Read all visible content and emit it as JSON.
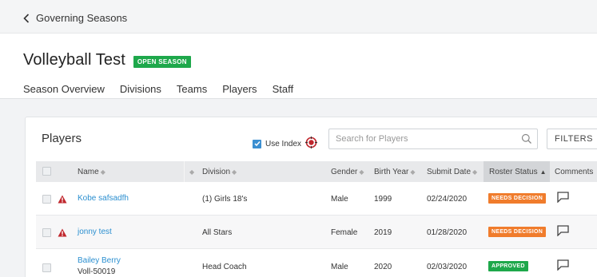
{
  "nav": {
    "back_label": "Governing Seasons"
  },
  "season": {
    "title": "Volleyball Test",
    "badge": "OPEN SEASON"
  },
  "tabs": [
    {
      "label": "Season Overview",
      "active": false
    },
    {
      "label": "Divisions",
      "active": false
    },
    {
      "label": "Teams",
      "active": false
    },
    {
      "label": "Players",
      "active": true
    },
    {
      "label": "Staff",
      "active": false
    }
  ],
  "players_panel": {
    "title": "Players",
    "use_index_label": "Use Index",
    "use_index_checked": true,
    "search_placeholder": "Search for Players",
    "filters_label": "FILTERS"
  },
  "table": {
    "columns": {
      "name": "Name",
      "division": "Division",
      "gender": "Gender",
      "birth_year": "Birth Year",
      "submit_date": "Submit Date",
      "roster_status": "Roster Status",
      "comments": "Comments"
    },
    "rows": [
      {
        "name": "Kobe safsadfh",
        "sub": "",
        "warning": true,
        "division": "(1) Girls 18's",
        "gender": "Male",
        "birth_year": "1999",
        "submit_date": "02/24/2020",
        "status": "NEEDS DECISION"
      },
      {
        "name": "jonny test",
        "sub": "",
        "warning": true,
        "division": "All Stars",
        "gender": "Female",
        "birth_year": "2019",
        "submit_date": "01/28/2020",
        "status": "NEEDS DECISION"
      },
      {
        "name": "Bailey Berry",
        "sub": "Voll-50019",
        "warning": false,
        "division": "Head Coach",
        "gender": "Male",
        "birth_year": "2020",
        "submit_date": "02/03/2020",
        "status": "APPROVED"
      }
    ]
  },
  "colors": {
    "accent": "#2b8fd0",
    "open_badge": "#1ea84b",
    "needs_decision": "#f07c2c",
    "approved": "#1ea84b",
    "warning": "#c0272d"
  }
}
